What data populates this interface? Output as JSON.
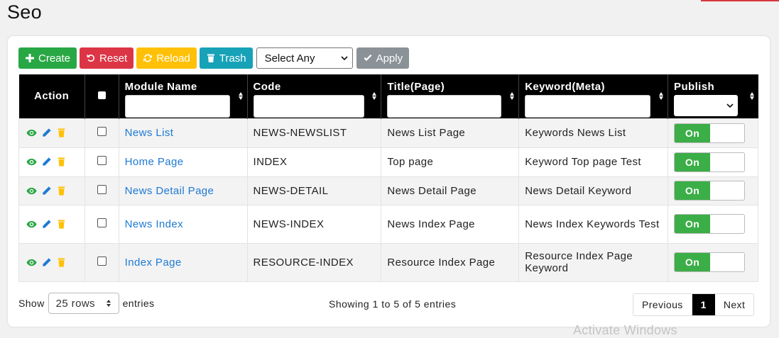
{
  "page": {
    "title": "Seo"
  },
  "toolbar": {
    "create_label": "Create",
    "reset_label": "Reset",
    "reload_label": "Reload",
    "trash_label": "Trash",
    "bulk_select_value": "Select Any",
    "apply_label": "Apply"
  },
  "table": {
    "headers": {
      "action": "Action",
      "module_name": "Module Name",
      "code": "Code",
      "title": "Title(Page)",
      "keyword": "Keyword(Meta)",
      "publish": "Publish"
    },
    "rows": [
      {
        "module_name": "News List",
        "code": "NEWS-NEWSLIST",
        "title": "News List Page",
        "keyword": "Keywords News List",
        "publish": "On"
      },
      {
        "module_name": "Home Page",
        "code": "INDEX",
        "title": "Top page",
        "keyword": "Keyword Top page Test",
        "publish": "On"
      },
      {
        "module_name": "News Detail Page",
        "code": "NEWS-DETAIL",
        "title": "News Detail Page",
        "keyword": "News Detail Keyword",
        "publish": "On"
      },
      {
        "module_name": "News Index",
        "code": "NEWS-INDEX",
        "title": "News Index Page",
        "keyword": "News Index Keywords Test",
        "publish": "On"
      },
      {
        "module_name": "Index Page",
        "code": "RESOURCE-INDEX",
        "title": "Resource Index Page",
        "keyword": "Resource Index Page Keyword",
        "publish": "On"
      }
    ]
  },
  "footer": {
    "show_label": "Show",
    "rows_value": "25 rows",
    "entries_label": "entries",
    "showing_text": "Showing 1 to 5 of 5 entries",
    "prev_label": "Previous",
    "current_page": "1",
    "next_label": "Next"
  },
  "watermark": "Activate Windows",
  "colors": {
    "create": "#28a745",
    "reset": "#dc3545",
    "reload": "#ffc107",
    "trash": "#17a2b8",
    "apply": "#8a9197",
    "link": "#1e7ad3",
    "toggle_on": "#3bae47",
    "header_bg": "#000000"
  }
}
